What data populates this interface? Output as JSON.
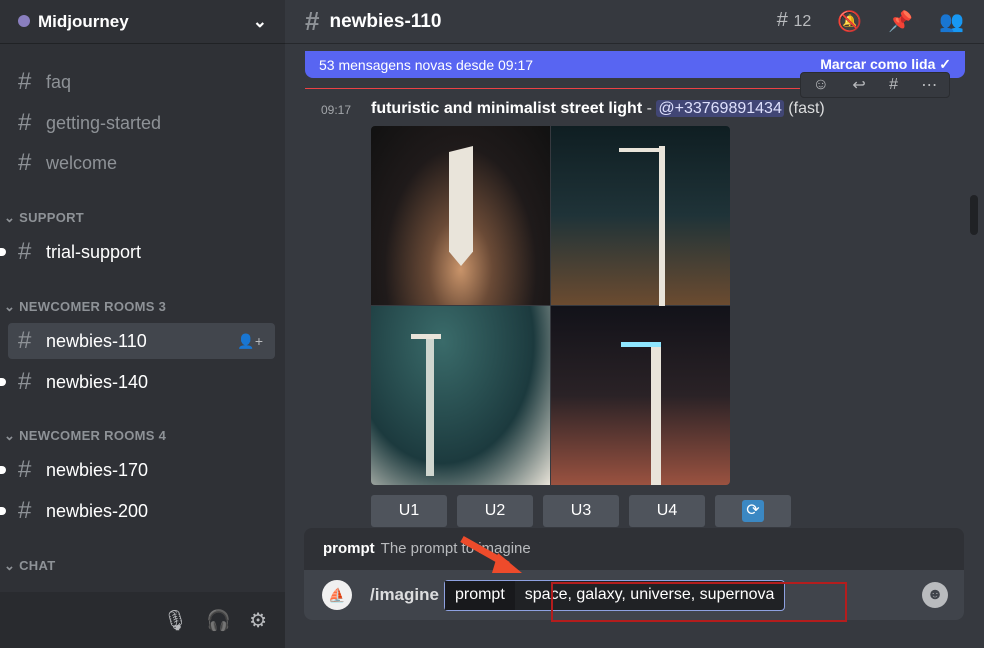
{
  "sidebar": {
    "server_name": "Midjourney",
    "channels_top": [
      {
        "name": "faq"
      },
      {
        "name": "getting-started"
      },
      {
        "name": "welcome"
      }
    ],
    "categories": [
      "SUPPORT",
      "NEWCOMER ROOMS 3",
      "NEWCOMER ROOMS 4",
      "CHAT"
    ],
    "support_channels": [
      {
        "name": "trial-support"
      }
    ],
    "newcomer3": [
      {
        "name": "newbies-110"
      },
      {
        "name": "newbies-140"
      }
    ],
    "newcomer4": [
      {
        "name": "newbies-170"
      },
      {
        "name": "newbies-200"
      }
    ]
  },
  "header": {
    "channel": "newbies-110",
    "threads_count": "12"
  },
  "banner": {
    "text": "53 mensagens novas desde 09:17",
    "action": "Marcar como lida"
  },
  "message": {
    "time": "09:17",
    "prompt": "futuristic and minimalist street light",
    "separator": " - ",
    "mention": "@+33769891434",
    "mode": "(fast)"
  },
  "buttons": [
    "U1",
    "U2",
    "U3",
    "U4"
  ],
  "autocomplete": {
    "option": "prompt",
    "description": "The prompt to imagine"
  },
  "input": {
    "command": "/imagine",
    "option": "prompt",
    "value": "space, galaxy, universe, supernova"
  },
  "colors": {
    "accent": "#5865f2",
    "highlight": "#b41d1d",
    "arrow": "#ee4b2b"
  }
}
